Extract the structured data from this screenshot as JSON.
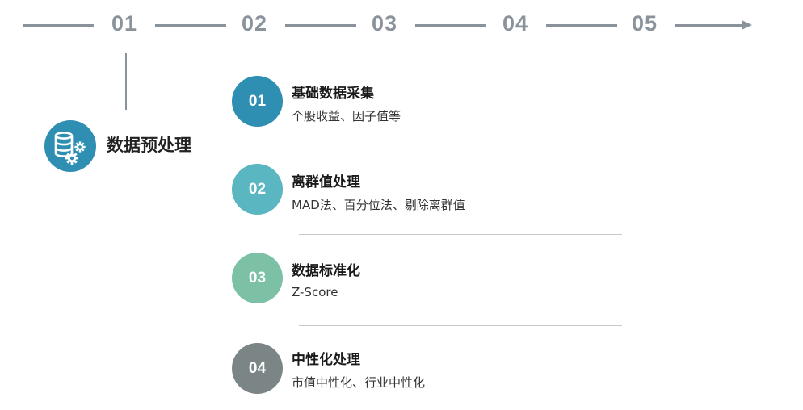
{
  "timeline": {
    "steps": [
      "01",
      "02",
      "03",
      "04",
      "05"
    ]
  },
  "section": {
    "title": "数据预处理",
    "icon": "database-gear-icon",
    "icon_color": "#2f8fb3"
  },
  "items": [
    {
      "number": "01",
      "title": "基础数据采集",
      "desc": "个股收益、因子值等",
      "color": "#2f8fb3"
    },
    {
      "number": "02",
      "title": "离群值处理",
      "desc": "MAD法、百分位法、剔除离群值",
      "color": "#5ab6c1"
    },
    {
      "number": "03",
      "title": "数据标准化",
      "desc": "Z-Score",
      "color": "#7cc1a6"
    },
    {
      "number": "04",
      "title": "中性化处理",
      "desc": "市值中性化、行业中性化",
      "color": "#7b8586"
    }
  ],
  "colors": {
    "timeline": "#8a929c",
    "separator": "#c6c9cd"
  }
}
